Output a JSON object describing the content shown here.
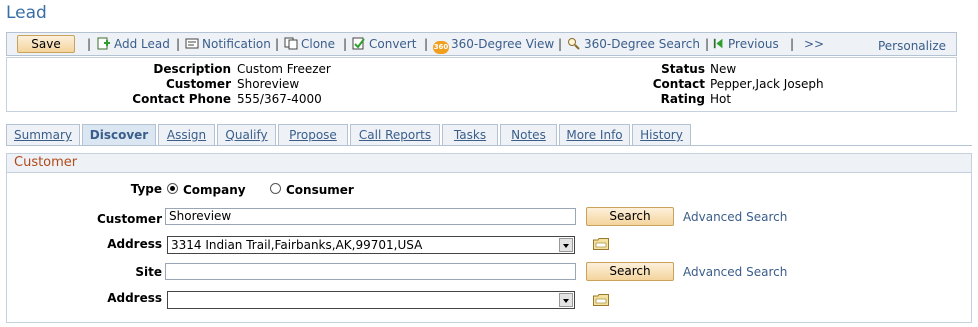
{
  "page": {
    "title": "Lead"
  },
  "toolbar": {
    "save_label": "Save",
    "add_lead": "Add Lead",
    "notification": "Notification",
    "clone": "Clone",
    "convert": "Convert",
    "view360_badge": "360",
    "view360": "360-Degree View",
    "search360": "360-Degree Search",
    "previous": "Previous",
    "more": ">>",
    "personalize": "Personalize",
    "separator": "|"
  },
  "summary": {
    "left": [
      {
        "label": "Description",
        "value": "Custom Freezer"
      },
      {
        "label": "Customer",
        "value": "Shoreview"
      },
      {
        "label": "Contact Phone",
        "value": "555/367-4000"
      }
    ],
    "right": [
      {
        "label": "Status",
        "value": "New"
      },
      {
        "label": "Contact",
        "value": "Pepper,Jack Joseph"
      },
      {
        "label": "Rating",
        "value": "Hot"
      }
    ]
  },
  "tabs": [
    {
      "label": "Summary",
      "active": false
    },
    {
      "label": "Discover",
      "active": true
    },
    {
      "label": "Assign",
      "active": false
    },
    {
      "label": "Qualify",
      "active": false
    },
    {
      "label": "Propose",
      "active": false
    },
    {
      "label": "Call Reports",
      "active": false
    },
    {
      "label": "Tasks",
      "active": false
    },
    {
      "label": "Notes",
      "active": false
    },
    {
      "label": "More Info",
      "active": false
    },
    {
      "label": "History",
      "active": false
    }
  ],
  "section": {
    "title": "Customer",
    "type_label": "Type",
    "type_options": [
      {
        "label": "Company",
        "selected": true
      },
      {
        "label": "Consumer",
        "selected": false
      }
    ],
    "customer_label": "Customer",
    "customer_value": "Shoreview",
    "address1_label": "Address",
    "address1_value": "3314 Indian Trail,Fairbanks,AK,99701,USA",
    "site_label": "Site",
    "site_value": "",
    "address2_label": "Address",
    "address2_value": "",
    "search_label": "Search",
    "advanced_search_label": "Advanced Search"
  },
  "colors": {
    "title": "#3a6ea5",
    "link": "#3a5d8a",
    "section_title": "#b04a1a",
    "button_gradient_top": "#fdf0dc",
    "button_gradient_bottom": "#f4d49c"
  }
}
